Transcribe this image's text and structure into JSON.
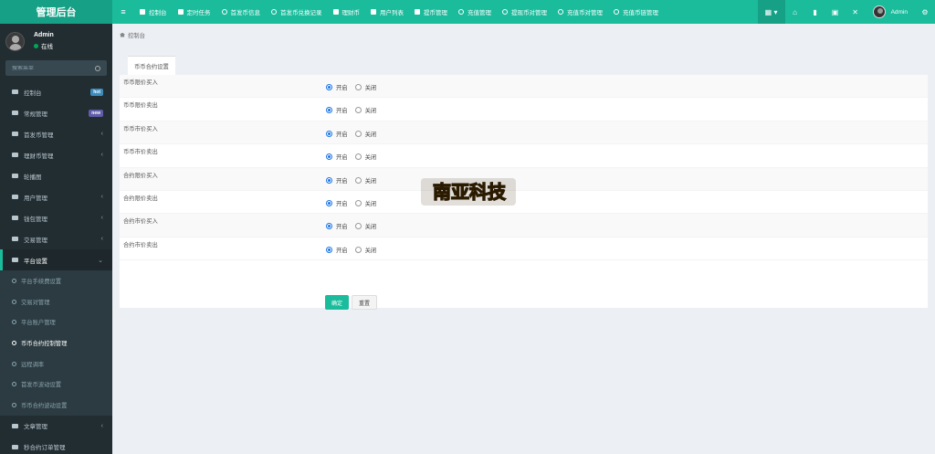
{
  "app": {
    "title": "管理后台"
  },
  "topnav": {
    "items": [
      {
        "label": "控制台",
        "icon": "dashboard-icon"
      },
      {
        "label": "定时任务",
        "icon": "list-icon"
      },
      {
        "label": "首发币信息",
        "icon": "circle-icon"
      },
      {
        "label": "首发币兑换记录",
        "icon": "circle-icon"
      },
      {
        "label": "理财币",
        "icon": "exchange-icon"
      },
      {
        "label": "用户列表",
        "icon": "user-icon"
      },
      {
        "label": "提币管理",
        "icon": "cloud-icon"
      },
      {
        "label": "充值管理",
        "icon": "circle-icon"
      },
      {
        "label": "提现币对管理",
        "icon": "circle-icon"
      },
      {
        "label": "充值币对管理",
        "icon": "circle-icon"
      },
      {
        "label": "充值币链管理",
        "icon": "circle-icon"
      }
    ],
    "user_name": "Admin"
  },
  "sidebar": {
    "user": {
      "name": "Admin",
      "status": "在线"
    },
    "search_placeholder": "搜索菜单",
    "items": [
      {
        "label": "控制台",
        "badge": "hot",
        "badge_color": "#3c8dbc"
      },
      {
        "label": "常规管理",
        "badge": "new",
        "badge_color": "#605ca8"
      },
      {
        "label": "首发币管理"
      },
      {
        "label": "理财币管理"
      },
      {
        "label": "轮播图"
      },
      {
        "label": "用户管理"
      },
      {
        "label": "钱包管理"
      },
      {
        "label": "交易管理"
      },
      {
        "label": "平台设置"
      }
    ],
    "sub_items": [
      {
        "label": "平台手续费设置"
      },
      {
        "label": "交易对管理"
      },
      {
        "label": "平台账户管理"
      },
      {
        "label": "币币合约控制管理"
      },
      {
        "label": "远程调率"
      },
      {
        "label": "首发币波动设置"
      },
      {
        "label": "币币合约波动设置"
      }
    ],
    "after_items": [
      {
        "label": "文章管理"
      },
      {
        "label": "秒合约订单管理"
      }
    ]
  },
  "breadcrumb": {
    "home": "控制台"
  },
  "panel": {
    "tab": "币币合约设置",
    "rows": [
      {
        "label": "币币限价买入",
        "on": "开启",
        "off": "关闭",
        "value": "on"
      },
      {
        "label": "币币限价卖出",
        "on": "开启",
        "off": "关闭",
        "value": "on"
      },
      {
        "label": "币币市价买入",
        "on": "开启",
        "off": "关闭",
        "value": "on"
      },
      {
        "label": "币币市价卖出",
        "on": "开启",
        "off": "关闭",
        "value": "on"
      },
      {
        "label": "合约限价买入",
        "on": "开启",
        "off": "关闭",
        "value": "on"
      },
      {
        "label": "合约限价卖出",
        "on": "开启",
        "off": "关闭",
        "value": "on"
      },
      {
        "label": "合约市价买入",
        "on": "开启",
        "off": "关闭",
        "value": "on"
      },
      {
        "label": "合约市价卖出",
        "on": "开启",
        "off": "关闭",
        "value": "on"
      }
    ],
    "submit": "确定",
    "reset": "重置"
  },
  "watermark": {
    "text": "南亚科技"
  },
  "colors": {
    "accent": "#1abc9c",
    "accent_dark": "#16a085",
    "sidebar": "#222d32"
  }
}
